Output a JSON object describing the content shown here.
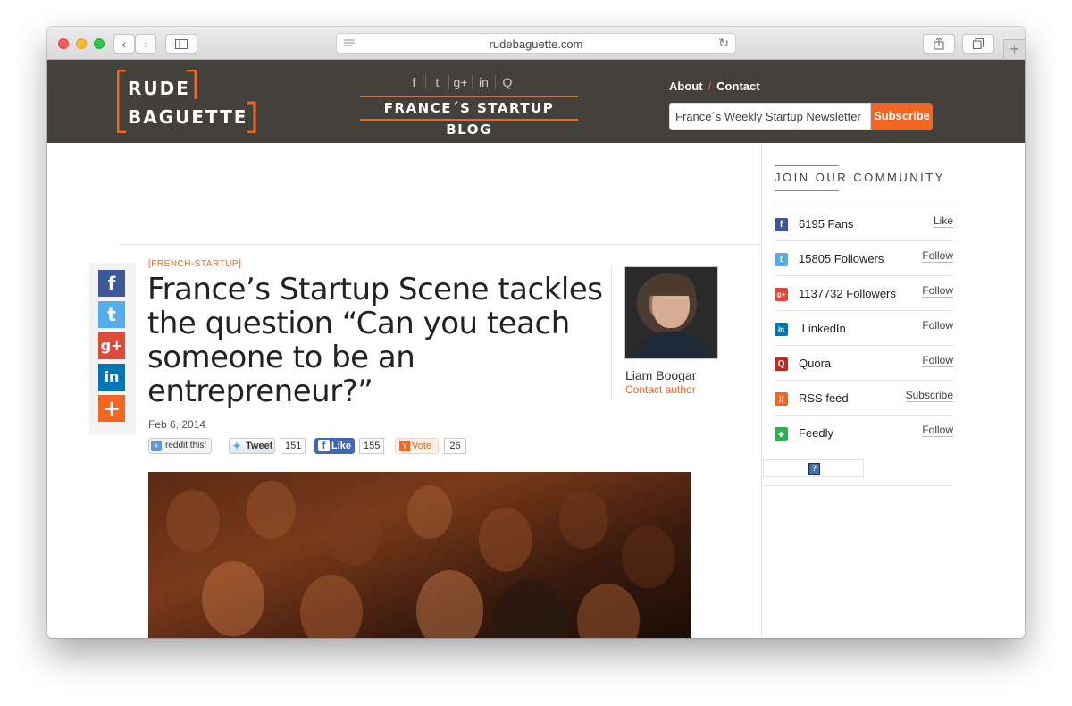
{
  "browser": {
    "url": "rudebaguette.com",
    "back_icon": "chevron-left-icon",
    "forward_icon": "chevron-right-icon",
    "new_tab_symbol": "+"
  },
  "header": {
    "logo_line1": "RUDE",
    "logo_line2": "BAGUETTE",
    "blog_title": "FRANCE´S STARTUP BLOG",
    "social_icons": [
      "f",
      "t",
      "g+",
      "in",
      "Q"
    ],
    "nav": {
      "about": "About",
      "separator": "/",
      "contact": "Contact"
    },
    "newsletter": {
      "value": "France´s Weekly Startup Newsletter",
      "button": "Subscribe"
    }
  },
  "article": {
    "category": "[FRENCH-STARTUP]",
    "title": "France’s Startup Scene tackles the question “Can you teach someone to be an entrepreneur?”",
    "date": "Feb 6, 2014",
    "author": {
      "name": "Liam Boogar",
      "contact": "Contact author"
    },
    "share_buttons": [
      "f",
      "t",
      "g+",
      "in",
      "+"
    ],
    "share_counts": {
      "reddit": {
        "label": "reddit this!"
      },
      "tweet": {
        "label": "Tweet",
        "count": "151"
      },
      "like": {
        "label": "Like",
        "count": "155"
      },
      "vote": {
        "label": "Vote",
        "count": "26"
      }
    }
  },
  "sidebar": {
    "title": "JOIN OUR COMMUNITY",
    "items": [
      {
        "icon": "facebook-icon",
        "glyph": "f",
        "color": "#3b5998",
        "label": "6195 Fans",
        "action": "Like"
      },
      {
        "icon": "twitter-icon",
        "glyph": "t",
        "color": "#55acee",
        "label": "15805 Followers",
        "action": "Follow"
      },
      {
        "icon": "google-plus-icon",
        "glyph": "g+",
        "color": "#dd4b39",
        "label": "1137732 Followers",
        "action": "Follow"
      },
      {
        "icon": "linkedin-icon",
        "glyph": "in",
        "color": "#0077b5",
        "label": " LinkedIn",
        "action": "Follow"
      },
      {
        "icon": "quora-icon",
        "glyph": "Q",
        "color": "#b92b27",
        "label": "Quora",
        "action": "Follow"
      },
      {
        "icon": "rss-icon",
        "glyph": "))",
        "color": "#f26522",
        "label": "RSS feed",
        "action": "Subscribe"
      },
      {
        "icon": "feedly-icon",
        "glyph": "◆",
        "color": "#2bb24c",
        "label": "Feedly",
        "action": "Follow"
      }
    ],
    "placeholder_icon": "?"
  },
  "colors": {
    "accent": "#f26522",
    "header_bg": "#44403b"
  }
}
